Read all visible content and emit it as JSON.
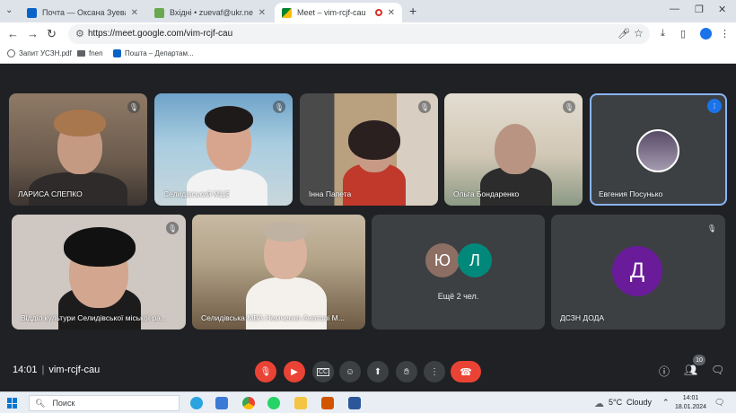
{
  "browser": {
    "tabs": [
      {
        "title": "Почта — Оксана Зуева — Outl",
        "icon": "outlook-icon",
        "active": false
      },
      {
        "title": "Вхідні • zuevaf@ukr.net",
        "icon": "ukrnet-icon",
        "active": false
      },
      {
        "title": "Meet – vim-rcjf-cau",
        "icon": "meet-icon",
        "active": true
      }
    ],
    "new_tab": "+",
    "url": "https://meet.google.com/vim-rcjf-cau",
    "bookmarks": [
      {
        "label": "Запит УСЗН.pdf",
        "icon": "globe-icon"
      },
      {
        "label": "fnen",
        "icon": "folder-icon"
      },
      {
        "label": "Пошта – Департам...",
        "icon": "outlook-icon"
      }
    ]
  },
  "meet": {
    "participants_row1": [
      {
        "name": "ЛАРИСА СЛЕПКО",
        "muted": true
      },
      {
        "name": "Селидівський МЦЗ",
        "muted": true
      },
      {
        "name": "Інна Папета",
        "muted": true
      },
      {
        "name": "Ольга Бондаренко",
        "muted": true
      },
      {
        "name": "Евгения Посунько",
        "speaking": true
      }
    ],
    "participants_row2": [
      {
        "name": "Відділ культури Селидівської міської ра...",
        "muted": true
      },
      {
        "name": "Селидівська МВА Немченко Анатолі М..."
      }
    ],
    "more": {
      "avatars": [
        "Ю",
        "Л"
      ],
      "avatar_colors": [
        "#8d6e63",
        "#00897b"
      ],
      "label": "Ещё 2 чел."
    },
    "dszn": {
      "name": "ДСЗН ДОДА",
      "initial": "Д",
      "color": "#6a1b9a",
      "muted": true
    }
  },
  "controls": {
    "time": "14:01",
    "separator": "|",
    "meeting_code": "vim-rcjf-cau",
    "participants_count": "10",
    "buttons": [
      "mic-off-icon",
      "camera-off-icon",
      "captions-icon",
      "emoji-icon",
      "present-icon",
      "raise-hand-icon",
      "more-options-icon",
      "hangup-icon"
    ]
  },
  "taskbar": {
    "search_placeholder": "Поиск",
    "weather_temp": "5°C",
    "weather_desc": "Cloudy",
    "clock_time": "14:01",
    "clock_date": "18.01.2024"
  }
}
